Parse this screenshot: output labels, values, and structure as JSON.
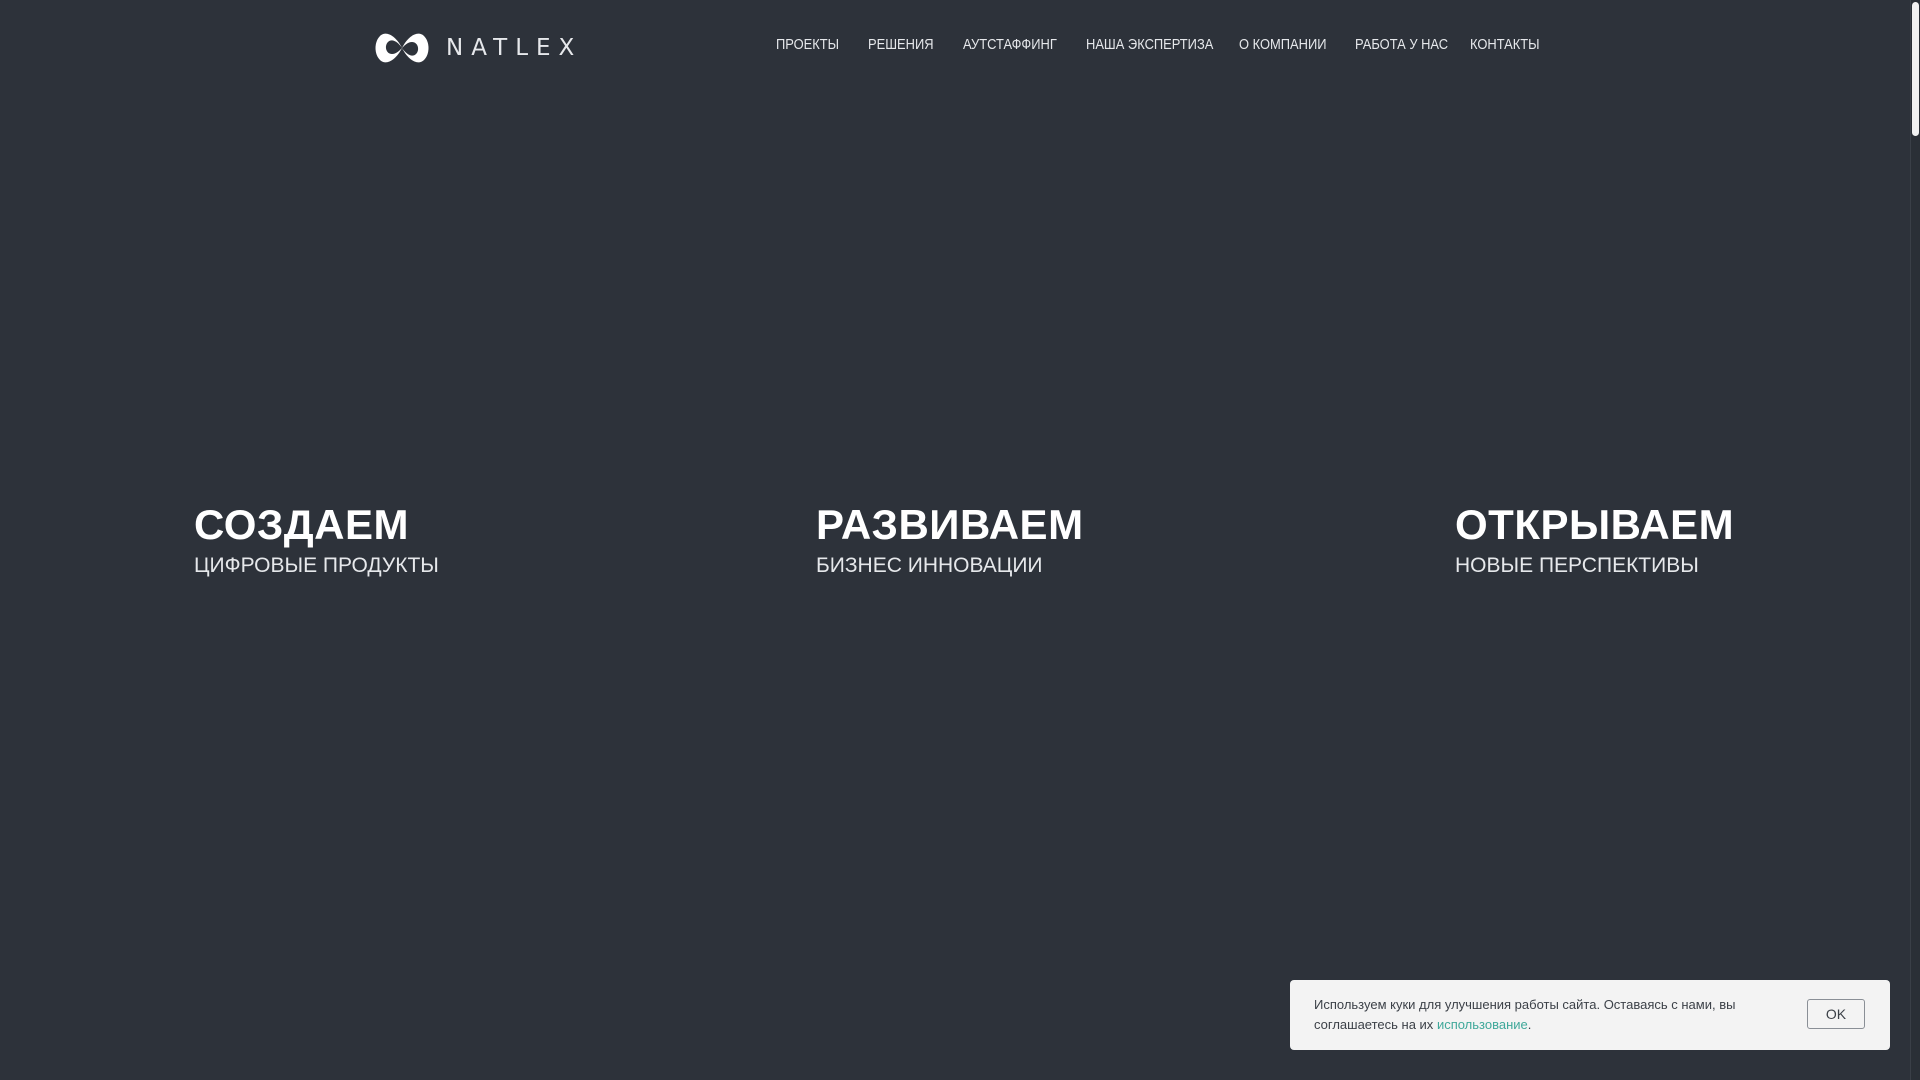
{
  "brand": {
    "name": "NATLEX"
  },
  "nav": {
    "items": [
      {
        "label": "ПРОЕКТЫ"
      },
      {
        "label": "РЕШЕНИЯ"
      },
      {
        "label": "АУТСТАФФИНГ"
      },
      {
        "label": "НАША ЭКСПЕРТИЗА"
      },
      {
        "label": "О КОМПАНИИ"
      },
      {
        "label": "РАБОТА У НАС"
      },
      {
        "label": "КОНТАКТЫ"
      }
    ]
  },
  "hero": {
    "blocks": [
      {
        "title": "СОЗДАЕМ",
        "subtitle": "ЦИФРОВЫЕ ПРОДУКТЫ"
      },
      {
        "title": "РАЗВИВАЕМ",
        "subtitle": "БИЗНЕС ИННОВАЦИИ"
      },
      {
        "title": "ОТКРЫВАЕМ",
        "subtitle": "НОВЫЕ ПЕРСПЕКТИВЫ"
      }
    ]
  },
  "cookie": {
    "text": "Используем куки для улучшения работы сайта. Оставаясь с нами, вы соглашаетесь на их ",
    "link_label": "использование",
    "suffix": ".",
    "ok_label": "OK"
  },
  "colors": {
    "background": "#2d323a",
    "text": "#ffffff",
    "link_accent": "#3fa89a",
    "banner_bg": "#f3f3f3"
  },
  "icons": {
    "logo": "natlex-logo-icon"
  }
}
